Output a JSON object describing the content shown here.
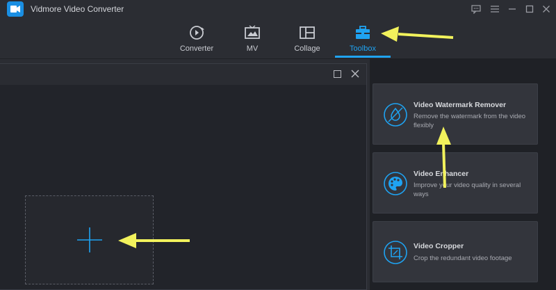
{
  "app": {
    "title": "Vidmore Video Converter"
  },
  "nav": {
    "items": [
      {
        "label": "Converter",
        "icon": "converter-icon"
      },
      {
        "label": "MV",
        "icon": "mv-icon"
      },
      {
        "label": "Collage",
        "icon": "collage-icon"
      },
      {
        "label": "Toolbox",
        "icon": "toolbox-icon",
        "active": true
      }
    ]
  },
  "tools": [
    {
      "title": "Video Watermark Remover",
      "desc": "Remove the watermark from the video flexibly",
      "icon": "watermark-remove-icon"
    },
    {
      "title": "Video Enhancer",
      "desc": "Improve your video quality in several ways",
      "icon": "palette-icon"
    },
    {
      "title": "Video Cropper",
      "desc": "Crop the redundant video footage",
      "icon": "crop-icon"
    }
  ],
  "colors": {
    "accent": "#1fa3f2",
    "annotation_arrow": "#f2f25c",
    "background": "#2b2d33"
  }
}
